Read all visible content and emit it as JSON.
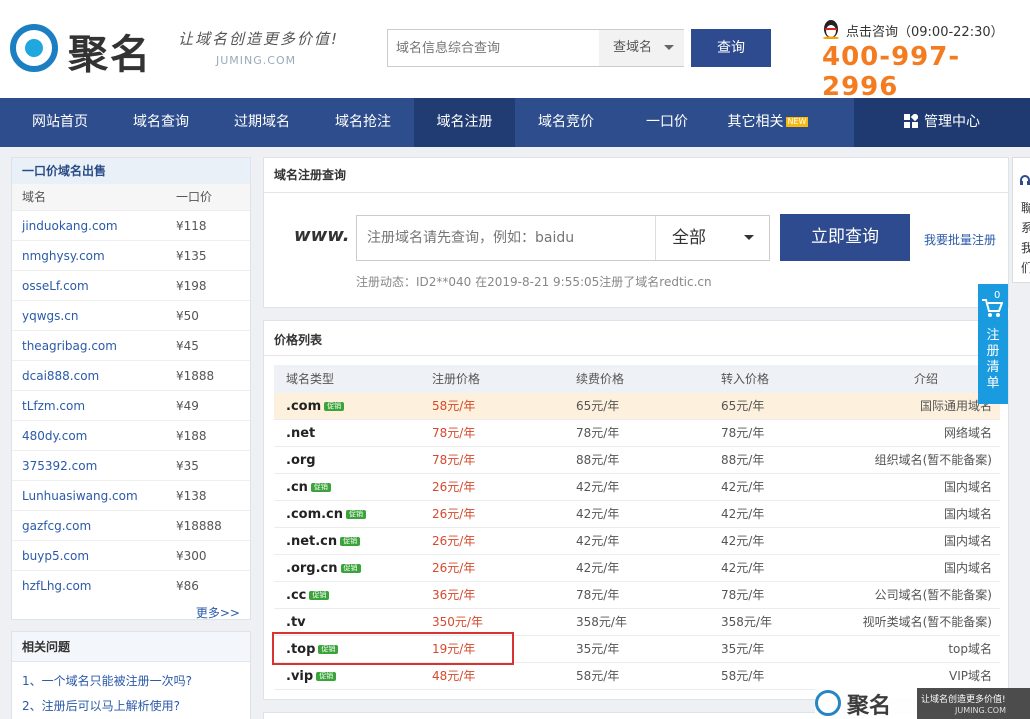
{
  "header": {
    "logo_text": "聚名",
    "slogan": "让域名创造更多价值!",
    "slogan_url": "JUMING.COM",
    "search_placeholder": "域名信息综合查询",
    "search_select": "查域名",
    "search_button": "查询",
    "consult": "点击咨询（09:00-22:30）",
    "phone": "400-997-2996"
  },
  "nav": {
    "items": [
      "网站首页",
      "域名查询",
      "过期域名",
      "域名抢注",
      "域名注册",
      "域名竞价",
      "一口价",
      "其它相关"
    ],
    "new_badge": "NEW",
    "manage": "管理中心"
  },
  "sidebar": {
    "title": "一口价域名出售",
    "col_domain": "域名",
    "col_price": "一口价",
    "rows": [
      {
        "d": "jinduokang.com",
        "p": "¥118"
      },
      {
        "d": "nmghysy.com",
        "p": "¥135"
      },
      {
        "d": "osseLf.com",
        "p": "¥198"
      },
      {
        "d": "yqwgs.cn",
        "p": "¥50"
      },
      {
        "d": "theagribag.com",
        "p": "¥45"
      },
      {
        "d": "dcai888.com",
        "p": "¥1888"
      },
      {
        "d": "tLfzm.com",
        "p": "¥49"
      },
      {
        "d": "480dy.com",
        "p": "¥188"
      },
      {
        "d": "375392.com",
        "p": "¥35"
      },
      {
        "d": "Lunhuasiwang.com",
        "p": "¥138"
      },
      {
        "d": "gazfcg.com",
        "p": "¥18888"
      },
      {
        "d": "buyp5.com",
        "p": "¥300"
      },
      {
        "d": "hzfLhg.com",
        "p": "¥86"
      }
    ],
    "more": "更多>>"
  },
  "faq": {
    "title": "相关问题",
    "items": [
      "1、一个域名只能被注册一次吗?",
      "2、注册后可以马上解析使用?"
    ]
  },
  "register": {
    "title": "域名注册查询",
    "www": "www.",
    "placeholder": "注册域名请先查询，例如：baidu",
    "select": "全部",
    "button": "立即查询",
    "bulk": "我要批量注册",
    "dynamic": "注册动态：ID2**040 在2019-8-21 9:55:05注册了域名redtic.cn"
  },
  "prices": {
    "title": "价格列表",
    "headers": [
      "域名类型",
      "注册价格",
      "续费价格",
      "转入价格",
      "介绍"
    ],
    "promo": "促销",
    "rows": [
      {
        "t": ".com",
        "promo": true,
        "r": "58元/年",
        "n": "65元/年",
        "x": "65元/年",
        "i": "国际通用域名"
      },
      {
        "t": ".net",
        "promo": false,
        "r": "78元/年",
        "n": "78元/年",
        "x": "78元/年",
        "i": "网络域名"
      },
      {
        "t": ".org",
        "promo": false,
        "r": "78元/年",
        "n": "88元/年",
        "x": "88元/年",
        "i": "组织域名(暂不能备案)"
      },
      {
        "t": ".cn",
        "promo": true,
        "r": "26元/年",
        "n": "42元/年",
        "x": "42元/年",
        "i": "国内域名"
      },
      {
        "t": ".com.cn",
        "promo": true,
        "r": "26元/年",
        "n": "42元/年",
        "x": "42元/年",
        "i": "国内域名"
      },
      {
        "t": ".net.cn",
        "promo": true,
        "r": "26元/年",
        "n": "42元/年",
        "x": "42元/年",
        "i": "国内域名"
      },
      {
        "t": ".org.cn",
        "promo": true,
        "r": "26元/年",
        "n": "42元/年",
        "x": "42元/年",
        "i": "国内域名"
      },
      {
        "t": ".cc",
        "promo": true,
        "r": "36元/年",
        "n": "78元/年",
        "x": "78元/年",
        "i": "公司域名(暂不能备案)"
      },
      {
        "t": ".tv",
        "promo": false,
        "r": "350元/年",
        "n": "358元/年",
        "x": "358元/年",
        "i": "视听类域名(暂不能备案)"
      },
      {
        "t": ".top",
        "promo": true,
        "r": "19元/年",
        "n": "35元/年",
        "x": "35元/年",
        "i": "top域名"
      },
      {
        "t": ".vip",
        "promo": true,
        "r": "48元/年",
        "n": "58元/年",
        "x": "58元/年",
        "i": "VIP域名"
      }
    ]
  },
  "cart": {
    "count": "0",
    "label": "注册清单"
  },
  "sidetab": {
    "chars": [
      "聯",
      "系",
      "我",
      "们"
    ]
  },
  "watermark": {
    "logo": "聚名",
    "tag": "让域名创造更多价值!",
    "url": "JUMING.COM"
  }
}
